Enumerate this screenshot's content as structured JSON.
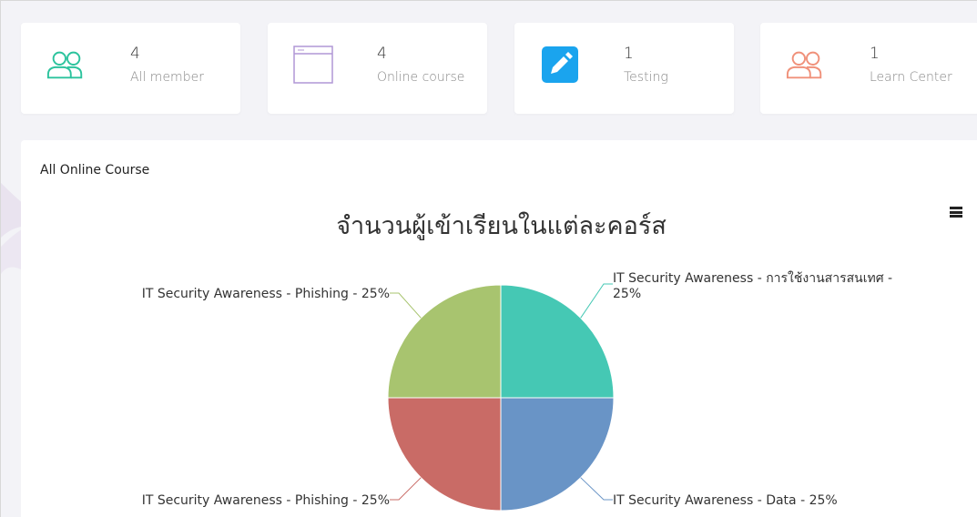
{
  "stats": [
    {
      "value": "4",
      "label": "All member",
      "icon": "users-icon",
      "color": "#2cc39d"
    },
    {
      "value": "4",
      "label": "Online course",
      "icon": "browser-window-icon",
      "color": "#b197d6"
    },
    {
      "value": "1",
      "label": "Testing",
      "icon": "pencil-icon",
      "color": "#1aa4ee"
    },
    {
      "value": "1",
      "label": "Learn Center",
      "icon": "users-icon",
      "color": "#f0917a"
    }
  ],
  "panel": {
    "title": "All Online Course",
    "menu_icon": "hamburger-menu-icon"
  },
  "chart_data": {
    "type": "pie",
    "title": "จำนวนผู้เข้าเรียนในแต่ละคอร์ส",
    "slices": [
      {
        "label": "IT Security Awareness - การใช้งานสารสนเทศ - 25%",
        "value": 25,
        "color": "#45c8b4"
      },
      {
        "label": "IT Security Awareness - Data - 25%",
        "value": 25,
        "color": "#6994c6"
      },
      {
        "label": "IT Security Awareness - Phishing - 25%",
        "value": 25,
        "color": "#c96b66"
      },
      {
        "label": "IT Security Awareness - Phishing - 25%",
        "value": 25,
        "color": "#a8c46f"
      }
    ]
  }
}
